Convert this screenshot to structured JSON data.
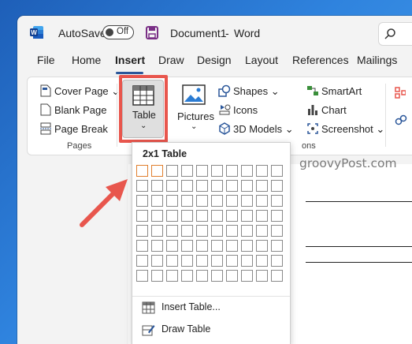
{
  "titlebar": {
    "autosave_label": "AutoSave",
    "autosave_state": "Off",
    "doc_title": "Document1",
    "separator": "-",
    "app_name": "Word"
  },
  "tabs": [
    {
      "label": "File"
    },
    {
      "label": "Home"
    },
    {
      "label": "Insert"
    },
    {
      "label": "Draw"
    },
    {
      "label": "Design"
    },
    {
      "label": "Layout"
    },
    {
      "label": "References"
    },
    {
      "label": "Mailings"
    }
  ],
  "active_tab": "Insert",
  "ribbon": {
    "pages": {
      "cover_page": "Cover Page",
      "blank_page": "Blank Page",
      "page_break": "Page Break",
      "group_label": "Pages"
    },
    "tables": {
      "table": "Table"
    },
    "illustrations": {
      "pictures": "Pictures",
      "shapes": "Shapes",
      "icons": "Icons",
      "models": "3D Models",
      "smartart": "SmartArt",
      "chart": "Chart",
      "screenshot": "Screenshot",
      "group_label_fragment": "ons"
    }
  },
  "table_menu": {
    "header": "2x1 Table",
    "grid": {
      "columns": 10,
      "rows": 8,
      "selected_columns": 2,
      "selected_rows": 1
    },
    "items": [
      {
        "label": "Insert Table..."
      },
      {
        "label": "Draw Table"
      }
    ]
  },
  "watermark": "groovyPost.com",
  "colors": {
    "word_blue": "#2b579a",
    "highlight_red": "#e8564d",
    "selection_orange": "#e1802f",
    "desktop_blue": "#2a6fc9"
  }
}
